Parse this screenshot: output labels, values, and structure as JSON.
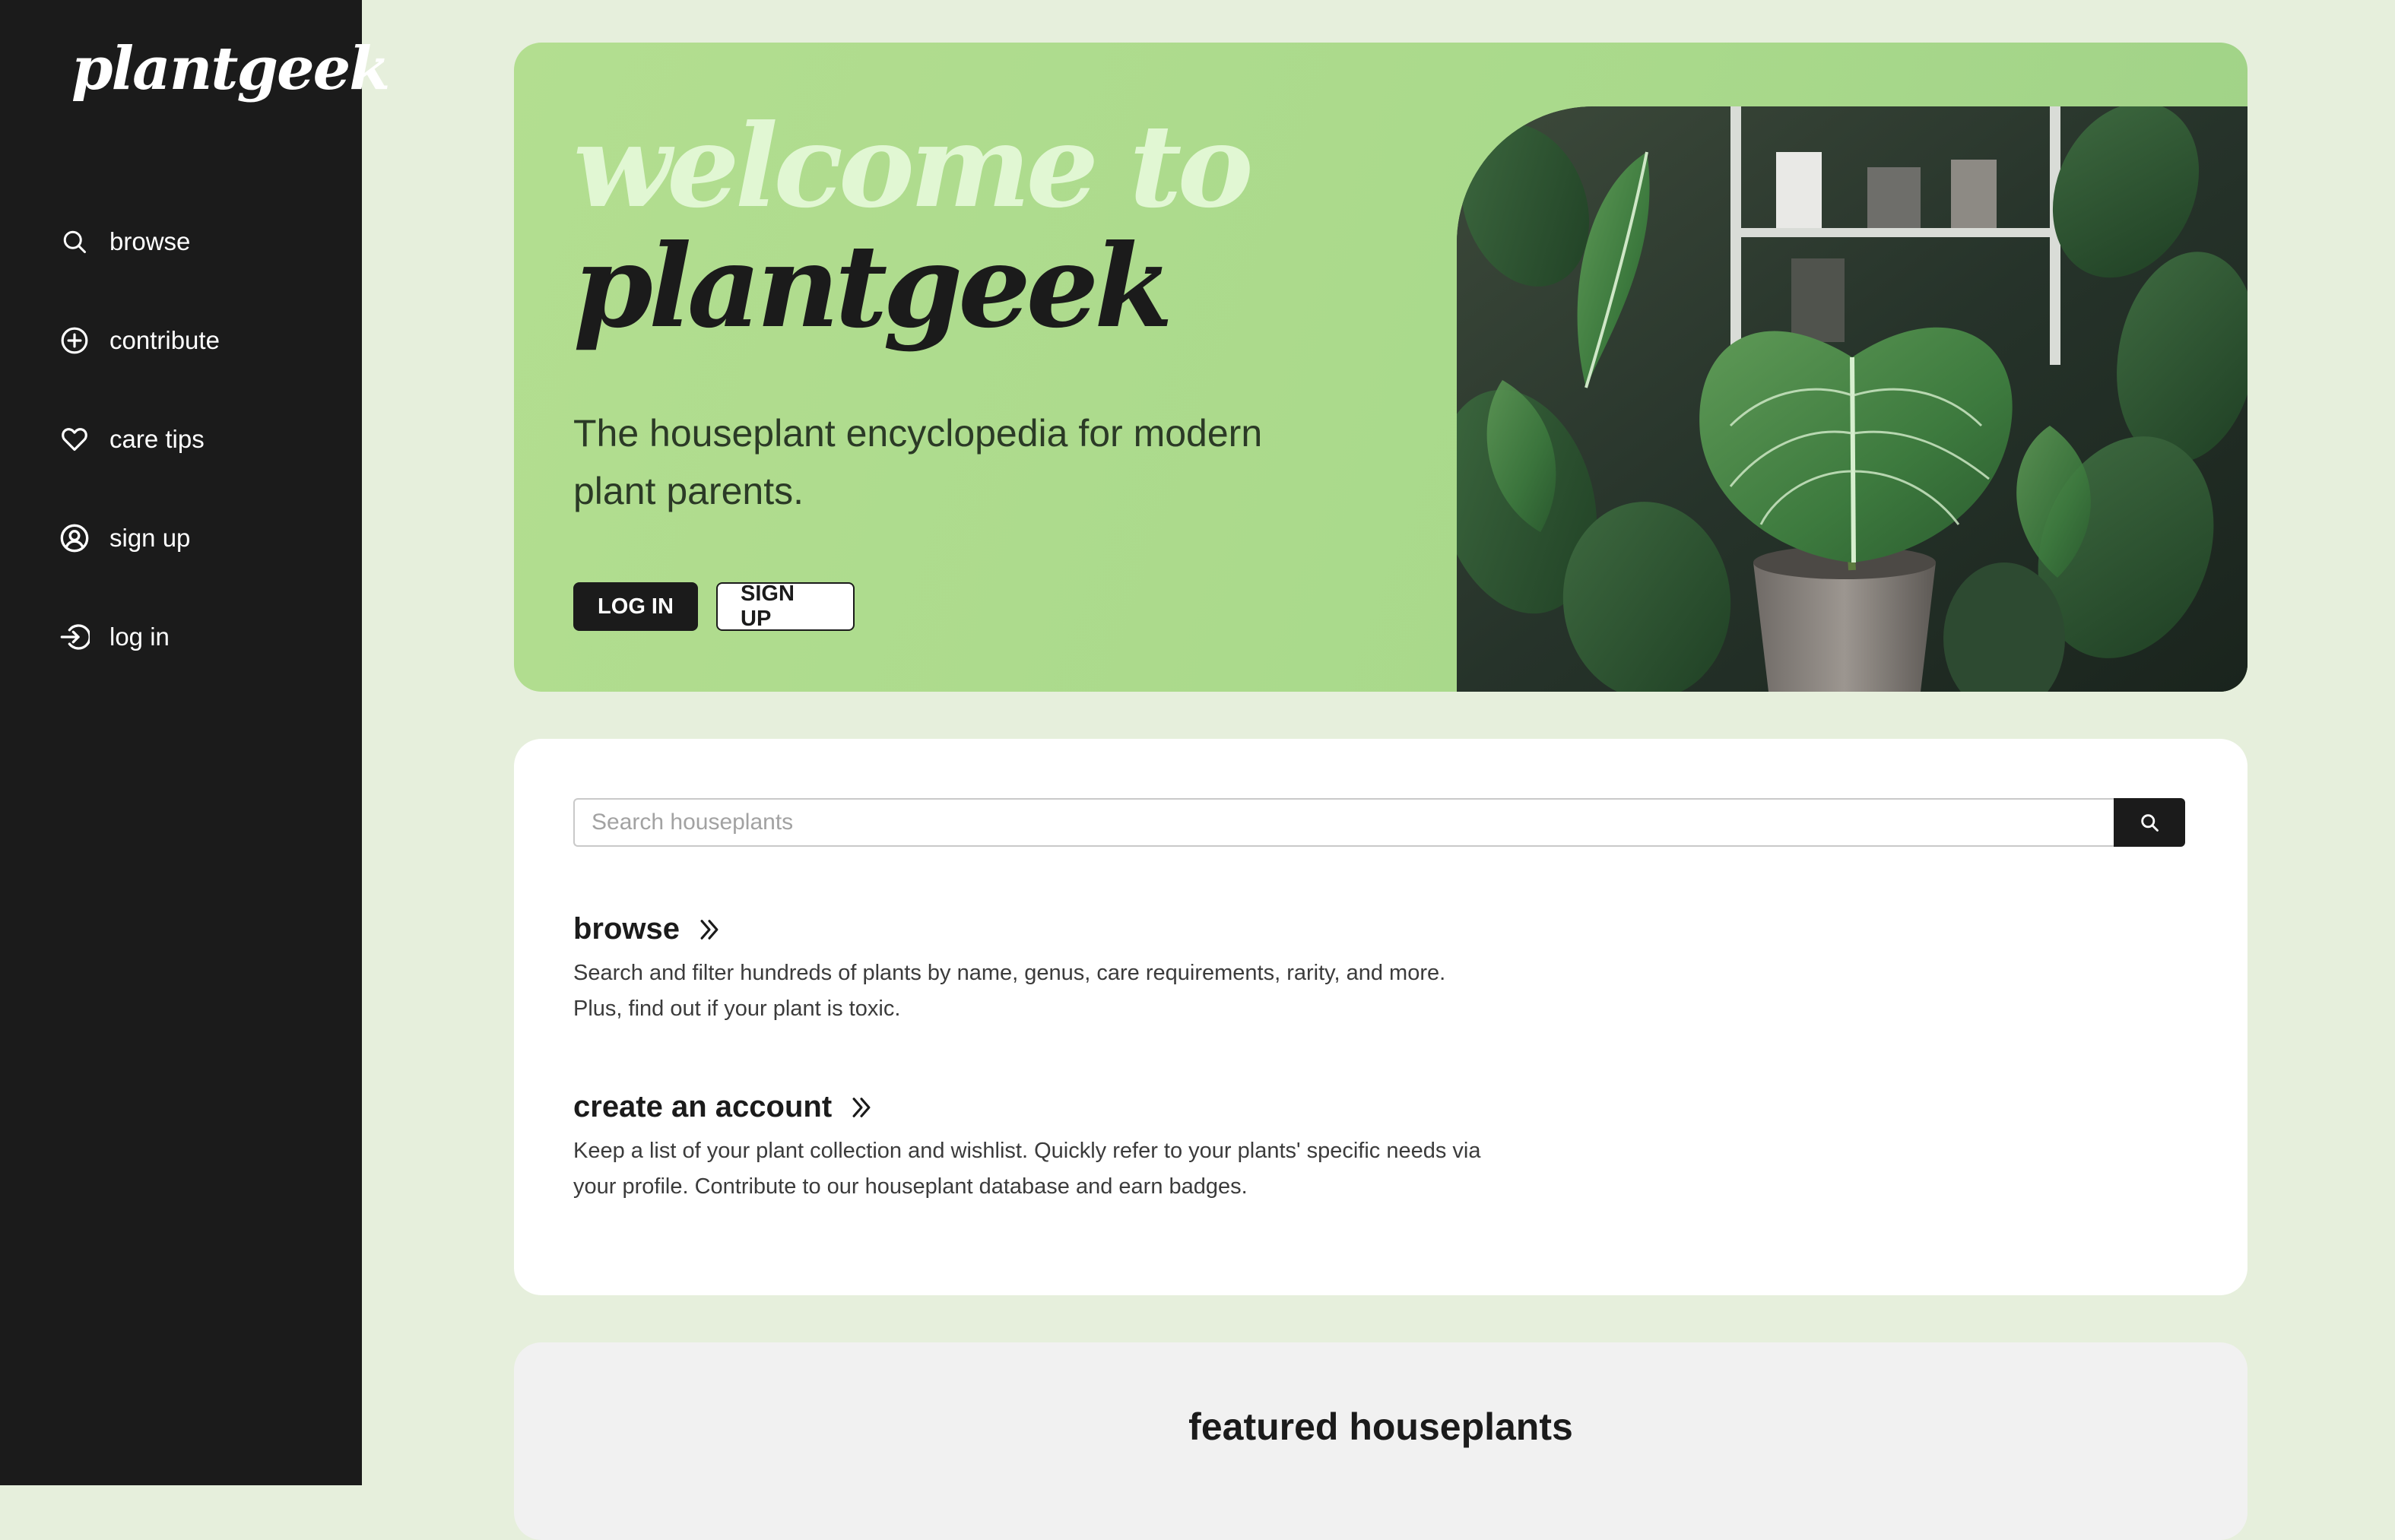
{
  "brand": "plantgeek",
  "sidebar": {
    "items": [
      {
        "label": "browse",
        "icon": "search-icon"
      },
      {
        "label": "contribute",
        "icon": "plus-circle-icon"
      },
      {
        "label": "care tips",
        "icon": "heart-icon"
      },
      {
        "label": "sign up",
        "icon": "user-circle-icon"
      },
      {
        "label": "log in",
        "icon": "login-icon"
      }
    ]
  },
  "hero": {
    "title_line1": "welcome to",
    "title_line2": "plantgeek",
    "subtitle": "The houseplant encyclopedia for modern plant parents.",
    "login_label": "LOG IN",
    "signup_label": "SIGN UP"
  },
  "search": {
    "placeholder": "Search houseplants"
  },
  "sections": {
    "browse": {
      "heading": "browse",
      "text": "Search and filter hundreds of plants by name, genus, care requirements, rarity, and more. Plus, find out if your plant is toxic."
    },
    "account": {
      "heading": "create an account",
      "text": "Keep a list of your plant collection and wishlist. Quickly refer to your plants' specific needs via your profile. Contribute to our houseplant database and earn badges."
    }
  },
  "featured": {
    "title": "featured houseplants"
  },
  "colors": {
    "sidebar_bg": "#1b1b1b",
    "page_bg": "#e6efdc",
    "hero_bg": "#b3de90",
    "hero_title_light": "#e1f7d3",
    "card_bg": "#ffffff",
    "featured_bg": "#f1f1f1"
  }
}
